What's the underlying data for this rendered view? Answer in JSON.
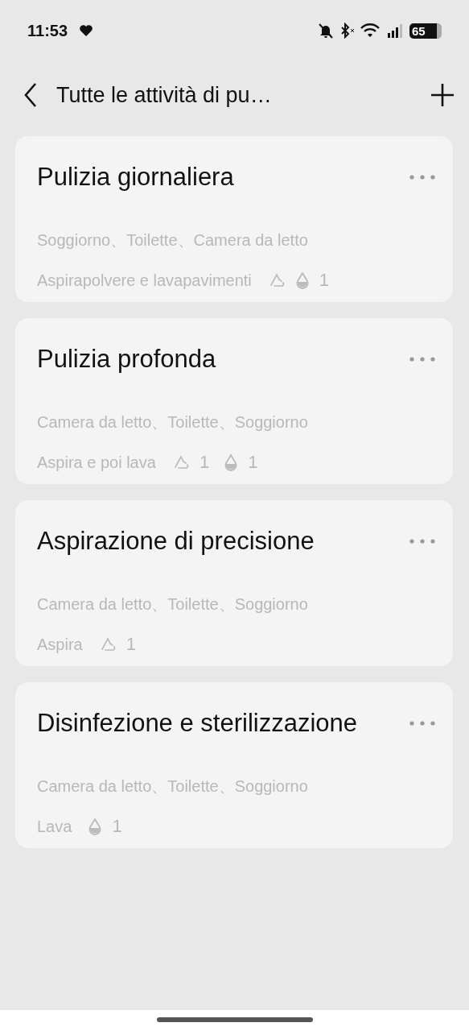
{
  "status_bar": {
    "time": "11:53",
    "battery": "65"
  },
  "header": {
    "title": "Tutte le attività di pu…"
  },
  "tasks": [
    {
      "title": "Pulizia giornaliera",
      "rooms": "Soggiorno、Toilette、Camera da letto",
      "mode": "Aspirapolvere e lavapavimenti",
      "settings": [
        {
          "kind": "suction"
        },
        {
          "kind": "water",
          "value": "1"
        }
      ]
    },
    {
      "title": "Pulizia profonda",
      "rooms": "Camera da letto、Toilette、Soggiorno",
      "mode": "Aspira e poi lava",
      "settings": [
        {
          "kind": "suction",
          "value": "1"
        },
        {
          "kind": "water",
          "value": "1"
        }
      ]
    },
    {
      "title": "Aspirazione di precisione",
      "rooms": "Camera da letto、Toilette、Soggiorno",
      "mode": "Aspira",
      "settings": [
        {
          "kind": "suction",
          "value": "1"
        }
      ]
    },
    {
      "title": "Disinfezione e sterilizzazione",
      "rooms": "Camera da letto、Toilette、Soggiorno",
      "mode": "Lava",
      "settings": [
        {
          "kind": "water",
          "value": "1"
        }
      ]
    }
  ]
}
